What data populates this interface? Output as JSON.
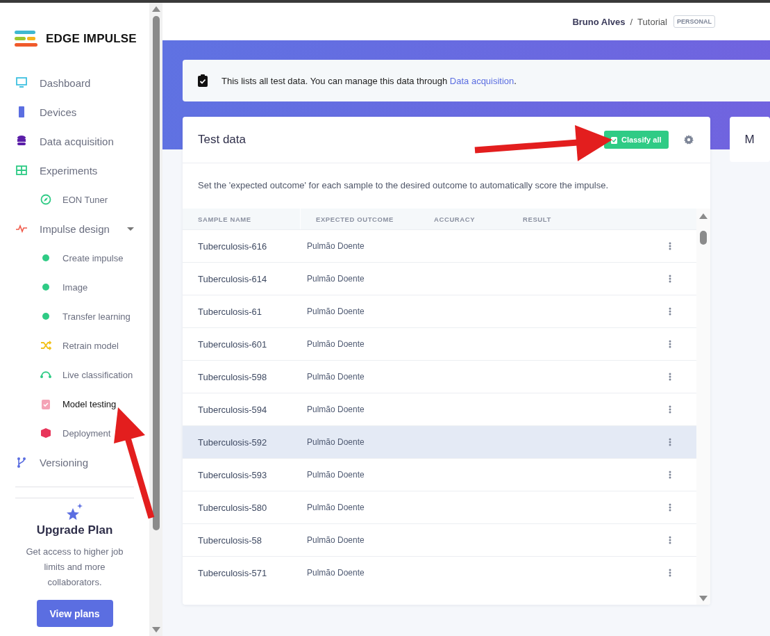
{
  "brand": {
    "name": "EDGE IMPULSE"
  },
  "sidebar": {
    "items": [
      {
        "label": "Dashboard",
        "selected": false
      },
      {
        "label": "Devices",
        "selected": false
      },
      {
        "label": "Data acquisition",
        "selected": false
      },
      {
        "label": "Experiments",
        "selected": false,
        "children": [
          {
            "label": "EON Tuner",
            "selected": false
          }
        ]
      },
      {
        "label": "Impulse design",
        "selected": false,
        "expanded": true,
        "children": [
          {
            "label": "Create impulse",
            "selected": false
          },
          {
            "label": "Image",
            "selected": false
          },
          {
            "label": "Transfer learning",
            "selected": false
          },
          {
            "label": "Retrain model",
            "selected": false
          },
          {
            "label": "Live classification",
            "selected": false
          },
          {
            "label": "Model testing",
            "selected": true
          },
          {
            "label": "Deployment",
            "selected": false
          }
        ]
      },
      {
        "label": "Versioning",
        "selected": false
      }
    ],
    "upgrade": {
      "title": "Upgrade Plan",
      "text": "Get access to higher job limits and more collaborators.",
      "button": "View plans"
    }
  },
  "header": {
    "user": "Bruno Alves",
    "separator": "/",
    "project": "Tutorial",
    "badge": "PERSONAL"
  },
  "info": {
    "text": "This lists all test data. You can manage this data through ",
    "link": "Data acquisition",
    "after": "."
  },
  "test_card": {
    "title": "Test data",
    "button": "Classify all",
    "description": "Set the 'expected outcome' for each sample to the desired outcome to automatically score the impulse.",
    "table": {
      "columns": [
        "SAMPLE NAME",
        "EXPECTED OUTCOME",
        "ACCURACY",
        "RESULT"
      ],
      "rows": [
        {
          "name": "Tuberculosis-616",
          "expected": "Pulmão Doente",
          "hovered": false
        },
        {
          "name": "Tuberculosis-614",
          "expected": "Pulmão Doente",
          "hovered": false
        },
        {
          "name": "Tuberculosis-61",
          "expected": "Pulmão Doente",
          "hovered": false
        },
        {
          "name": "Tuberculosis-601",
          "expected": "Pulmão Doente",
          "hovered": false
        },
        {
          "name": "Tuberculosis-598",
          "expected": "Pulmão Doente",
          "hovered": false
        },
        {
          "name": "Tuberculosis-594",
          "expected": "Pulmão Doente",
          "hovered": false
        },
        {
          "name": "Tuberculosis-592",
          "expected": "Pulmão Doente",
          "hovered": true
        },
        {
          "name": "Tuberculosis-593",
          "expected": "Pulmão Doente",
          "hovered": false
        },
        {
          "name": "Tuberculosis-580",
          "expected": "Pulmão Doente",
          "hovered": false
        },
        {
          "name": "Tuberculosis-58",
          "expected": "Pulmão Doente",
          "hovered": false
        },
        {
          "name": "Tuberculosis-571",
          "expected": "Pulmão Doente",
          "hovered": false
        }
      ]
    }
  },
  "side_card": {
    "title": "M"
  }
}
